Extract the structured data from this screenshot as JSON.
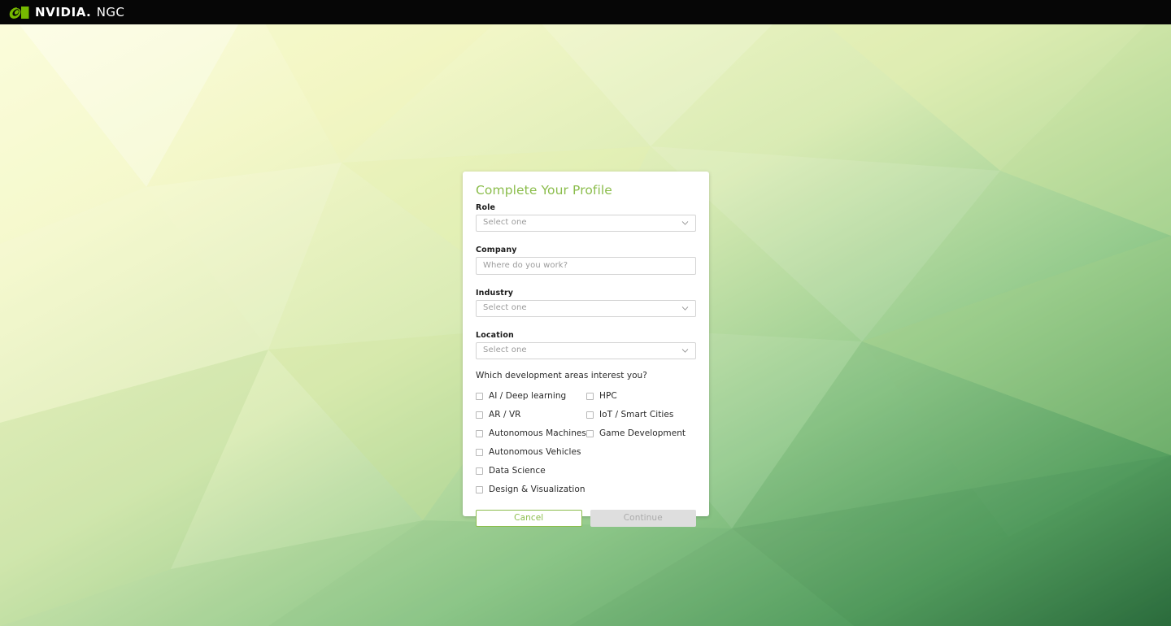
{
  "header": {
    "logo_icon": "nvidia-eye-logo",
    "brand": "NVIDIA",
    "brand_dot": ".",
    "product": "NGC",
    "background_color": "#060606"
  },
  "theme": {
    "nvidia_green": "#76b900",
    "title_green": "#8bbd4c",
    "card_background": "#ffffff",
    "disabled_gray": "#dedede",
    "disabled_text": "#ababab",
    "bg_top_left": "#fbfcd9",
    "bg_bottom_right": "#2d6e3e"
  },
  "card": {
    "title": "Complete Your Profile",
    "fields": [
      {
        "label": "Role",
        "type": "select",
        "placeholder": "Select one",
        "icon": "chevron-down-icon",
        "name": "role"
      },
      {
        "label": "Company",
        "type": "text",
        "placeholder": "Where do you work?",
        "value": "",
        "name": "company"
      },
      {
        "label": "Industry",
        "type": "select",
        "placeholder": "Select one",
        "icon": "chevron-down-icon",
        "name": "industry"
      },
      {
        "label": "Location",
        "type": "select",
        "placeholder": "Select one",
        "icon": "chevron-down-icon",
        "name": "location"
      }
    ],
    "interests": {
      "question": "Which development areas interest you?",
      "left_column": [
        {
          "label": "AI / Deep learning",
          "checked": false
        },
        {
          "label": "AR / VR",
          "checked": false
        },
        {
          "label": "Autonomous Machines",
          "checked": false
        },
        {
          "label": "Autonomous Vehicles",
          "checked": false
        },
        {
          "label": "Data Science",
          "checked": false
        },
        {
          "label": "Design & Visualization",
          "checked": false
        }
      ],
      "right_column": [
        {
          "label": "HPC",
          "checked": false
        },
        {
          "label": "IoT / Smart Cities",
          "checked": false
        },
        {
          "label": "Game Development",
          "checked": false
        }
      ]
    },
    "actions": {
      "cancel_label": "Cancel",
      "continue_label": "Continue",
      "continue_disabled": true
    }
  }
}
